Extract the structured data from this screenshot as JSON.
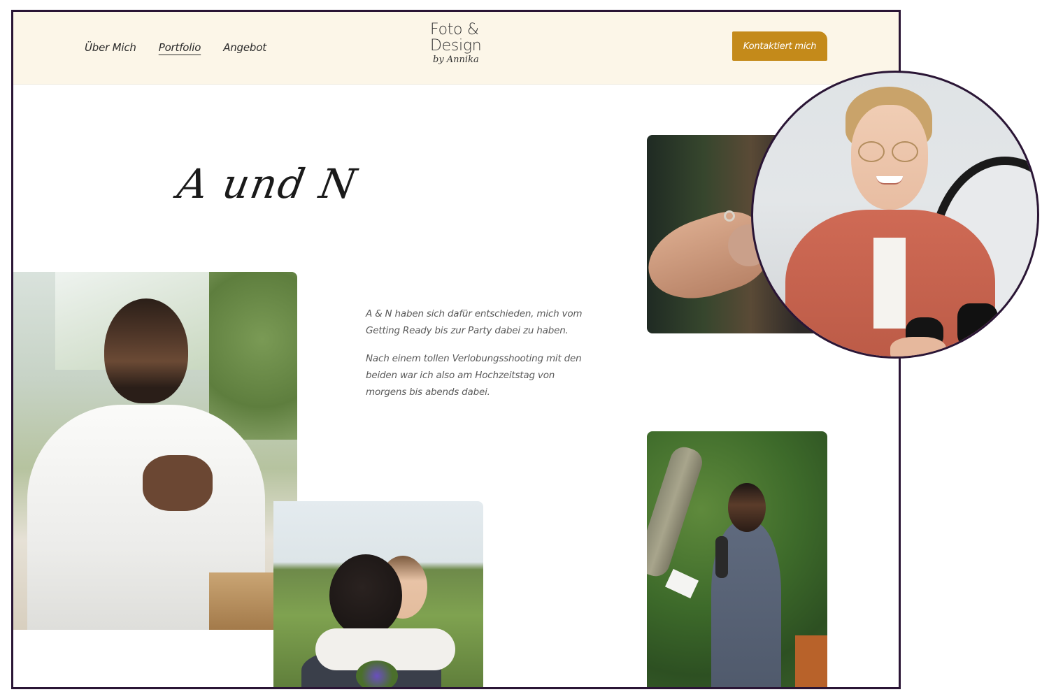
{
  "header": {
    "nav": [
      {
        "label": "Über Mich"
      },
      {
        "label": "Portfolio",
        "active": true
      },
      {
        "label": "Angebot"
      }
    ],
    "logo": {
      "line1": "Foto &",
      "line2": "Design",
      "line3": "by Annika"
    },
    "cta_label": "Kontaktiert mich"
  },
  "hero": {
    "title": "A und N"
  },
  "description": {
    "p1": "A & N haben sich dafür entschieden, mich vom Getting Ready bis zur Party dabei zu haben.",
    "p2": "Nach einem tollen Verlobungsshooting mit den beiden war ich also am Hochzeitstag von morgens bis abends dabei."
  },
  "colors": {
    "header_bg": "#fcf6e8",
    "accent": "#c48a1a",
    "frame_border": "#2a1535"
  }
}
